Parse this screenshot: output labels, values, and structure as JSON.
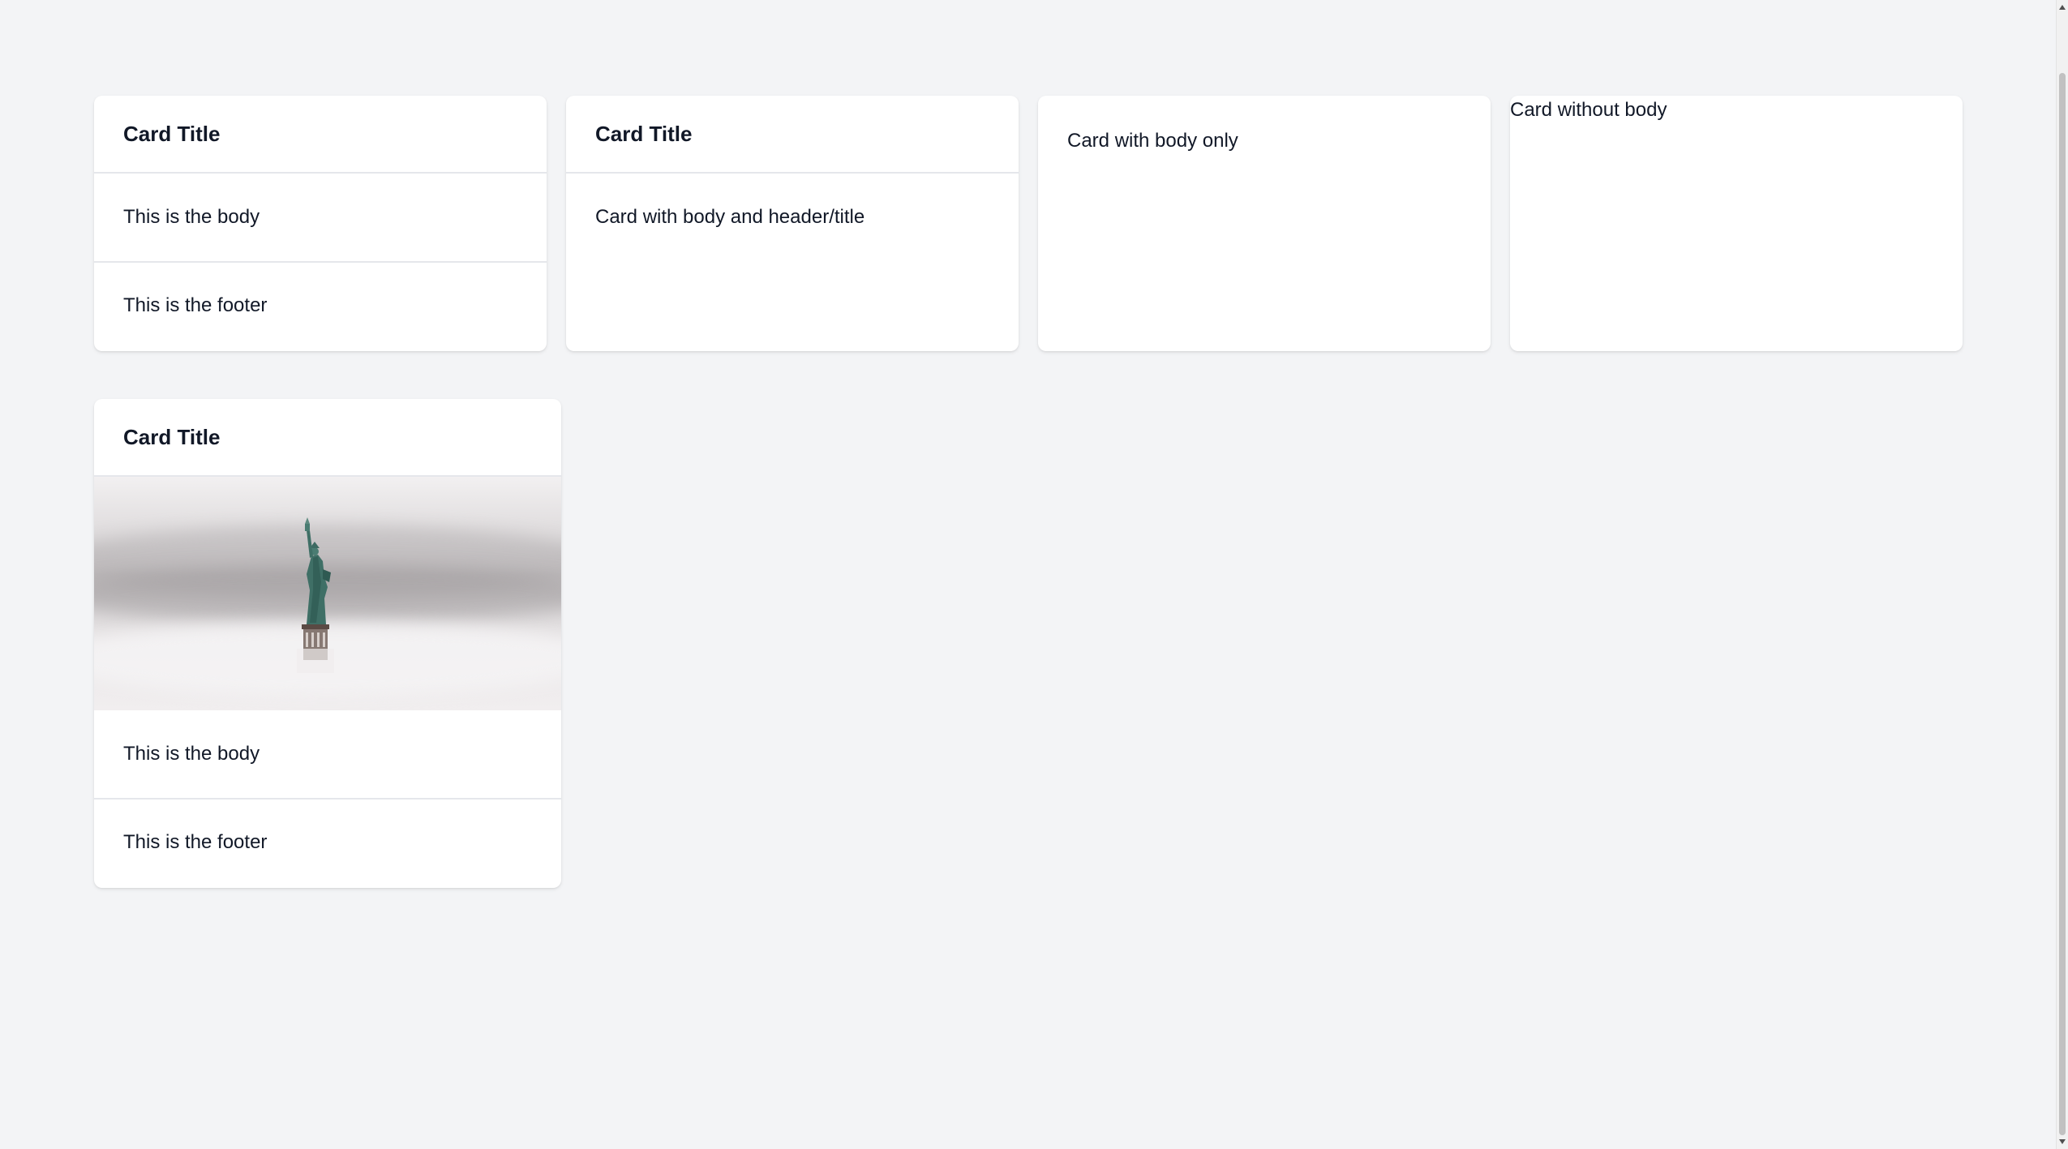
{
  "cards": {
    "full": {
      "title": "Card Title",
      "body": "This is the body",
      "footer": "This is the footer"
    },
    "header_body": {
      "title": "Card Title",
      "body": "Card with body and header/title"
    },
    "body_only": {
      "body": "Card with body only"
    },
    "no_body": {
      "content": "Card without body"
    },
    "image_card": {
      "title": "Card Title",
      "image_icon": "statue-of-liberty-image",
      "body": "This is the body",
      "footer": "This is the footer"
    }
  }
}
